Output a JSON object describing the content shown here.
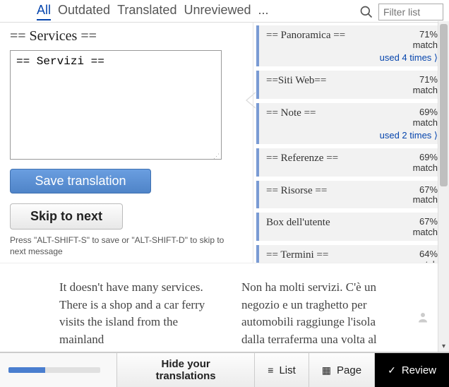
{
  "tabs": {
    "all": "All",
    "outdated": "Outdated",
    "translated": "Translated",
    "unreviewed": "Unreviewed",
    "more": "..."
  },
  "filter": {
    "placeholder": "Filter list"
  },
  "editor": {
    "source": "== Services ==",
    "translation": "== Servizi ==",
    "save_label": "Save translation",
    "skip_label": "Skip to next",
    "shortcut_hint": "Press \"ALT-SHIFT-S\" to save or \"ALT-SHIFT-D\" to skip to next message"
  },
  "suggestions": [
    {
      "text": "== Panoramica ==",
      "pct": "71%",
      "match": "match",
      "used": "used 4 times ⟩"
    },
    {
      "text": "==Siti Web==",
      "pct": "71%",
      "match": "match"
    },
    {
      "text": "== Note ==",
      "pct": "69%",
      "match": "match",
      "used": "used 2 times ⟩"
    },
    {
      "text": "== Referenze ==",
      "pct": "69%",
      "match": "match"
    },
    {
      "text": "== Risorse ==",
      "pct": "67%",
      "match": "match"
    },
    {
      "text": "Box dell'utente",
      "pct": "67%",
      "match": "match"
    },
    {
      "text": "== Termini ==",
      "pct": "64%",
      "match": "match"
    }
  ],
  "context": {
    "en": "It doesn't have many services. There is a shop and a car ferry visits the island from the mainland",
    "it": "Non ha molti servizi. C'è un negozio e un traghetto per automobili raggiunge l'isola dalla terraferma una volta al"
  },
  "bottom": {
    "hide_label": "Hide your translations",
    "list_label": "List",
    "page_label": "Page",
    "review_label": "Review"
  }
}
